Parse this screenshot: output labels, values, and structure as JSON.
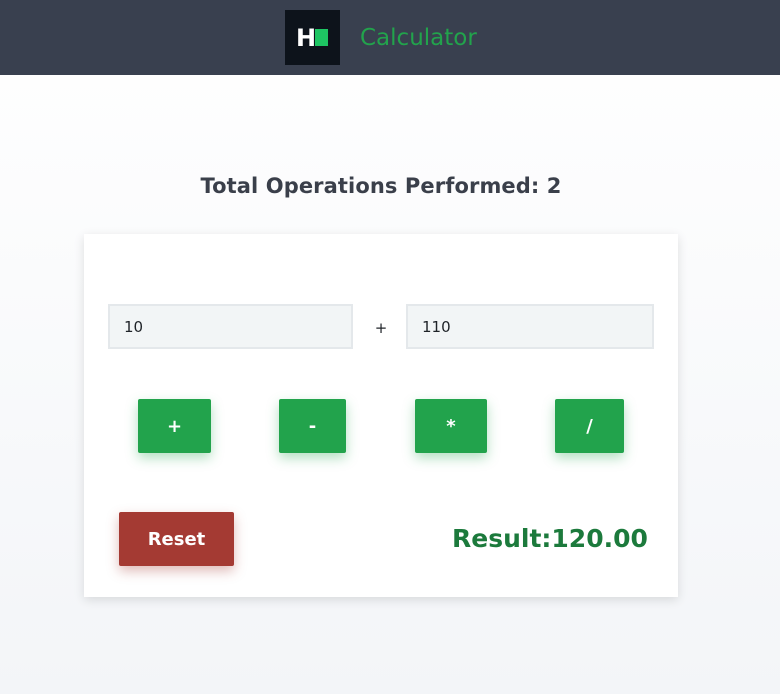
{
  "header": {
    "logo_icon": "hackerrank-logo-icon",
    "logo_letter": "H",
    "title": "Calculator",
    "title_color": "#22a34c",
    "background": "#39404f"
  },
  "stats": {
    "label": "Total Operations Performed: 2",
    "count": 2
  },
  "calculator": {
    "first_number": "10",
    "second_number": "110",
    "operator_symbol": "+",
    "operations": [
      {
        "label": "+",
        "name": "add"
      },
      {
        "label": "-",
        "name": "subtract"
      },
      {
        "label": "*",
        "name": "multiply"
      },
      {
        "label": "/",
        "name": "divide"
      }
    ],
    "button_color": "#22a34c",
    "reset_label": "Reset",
    "reset_color": "#a43a33",
    "result_text": "Result:120.00",
    "result_color": "#1c7a3c"
  }
}
